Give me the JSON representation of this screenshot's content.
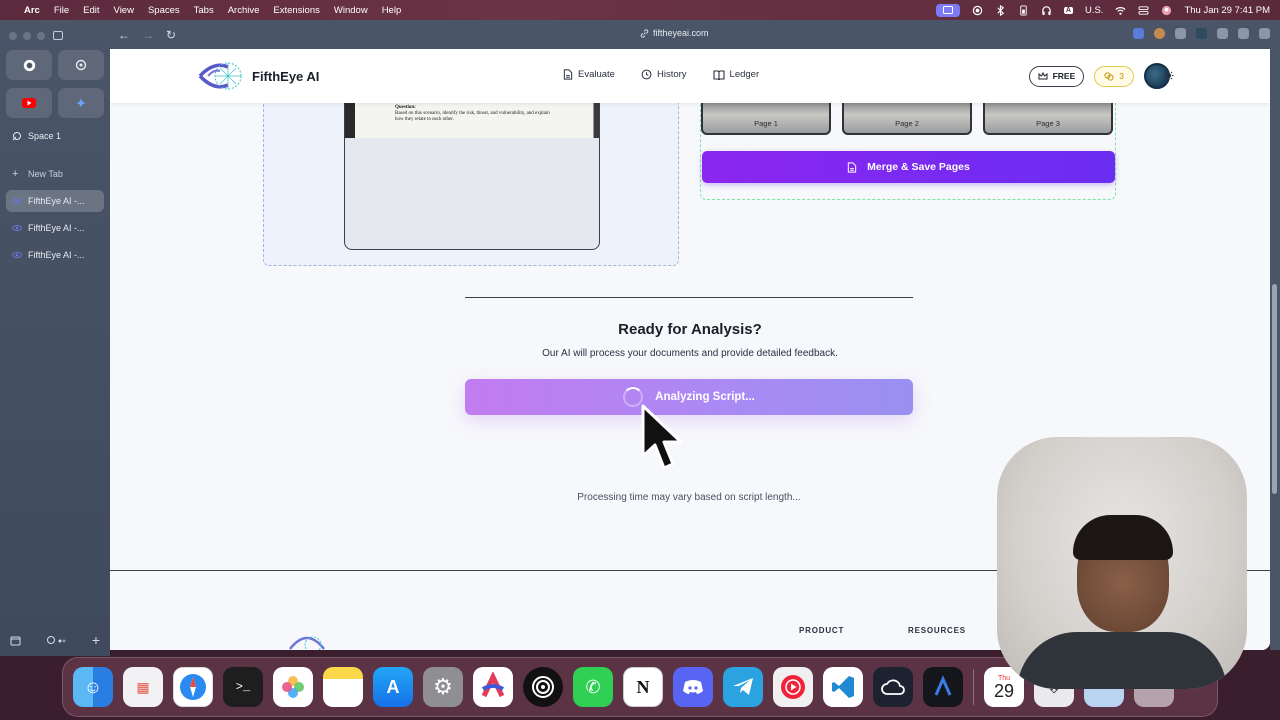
{
  "menubar": {
    "app": "Arc",
    "items": [
      "File",
      "Edit",
      "View",
      "Spaces",
      "Tabs",
      "Archive",
      "Extensions",
      "Window",
      "Help"
    ],
    "locale": "U.S.",
    "datetime": "Thu Jan 29  7:41 PM"
  },
  "browser": {
    "url": "fiftheyeai.com",
    "space_label": "Space 1",
    "new_tab_label": "New Tab",
    "tabs": [
      "FifthEye AI -...",
      "FifthEye AI -...",
      "FifthEye AI -..."
    ]
  },
  "header": {
    "brand": "FifthEye AI",
    "nav": [
      {
        "label": "Evaluate",
        "icon": "document-icon"
      },
      {
        "label": "History",
        "icon": "history-icon"
      },
      {
        "label": "Ledger",
        "icon": "book-icon"
      }
    ],
    "plan": "FREE",
    "credits": "3"
  },
  "upload": {
    "doc_lines": [
      "institutions in the region.",
      "Question:",
      "Based on this scenario, identify the risk, threat, and vulnerability, and explain",
      "how they relate to each other."
    ],
    "pages": [
      "Page 1",
      "Page 2",
      "Page 3"
    ],
    "merge_label": "Merge & Save Pages"
  },
  "analysis": {
    "title": "Ready for Analysis?",
    "subtitle": "Our AI will process your documents and provide detailed feedback.",
    "button_label": "Analyzing Script...",
    "note": "Processing time may vary based on script length..."
  },
  "footer": {
    "columns": [
      "PRODUCT",
      "RESOURCES"
    ]
  },
  "dock": {
    "calendar_month": "Thu",
    "calendar_day": "29",
    "apps": [
      "finder-icon",
      "launchpad-icon",
      "safari-icon",
      "terminal-icon",
      "photos-icon",
      "notes-icon",
      "app-store-icon",
      "settings-icon",
      "arc-icon",
      "chatgpt-icon",
      "whatsapp-icon",
      "notion-icon",
      "discord-icon",
      "telegram-icon",
      "youtube-music-icon",
      "vscode-icon",
      "cloud-icon",
      "ai-app-icon"
    ]
  },
  "colors": {
    "accent": "#7c2cf1",
    "analyze_button": "#b985f3",
    "credits": "#e5c94a"
  }
}
